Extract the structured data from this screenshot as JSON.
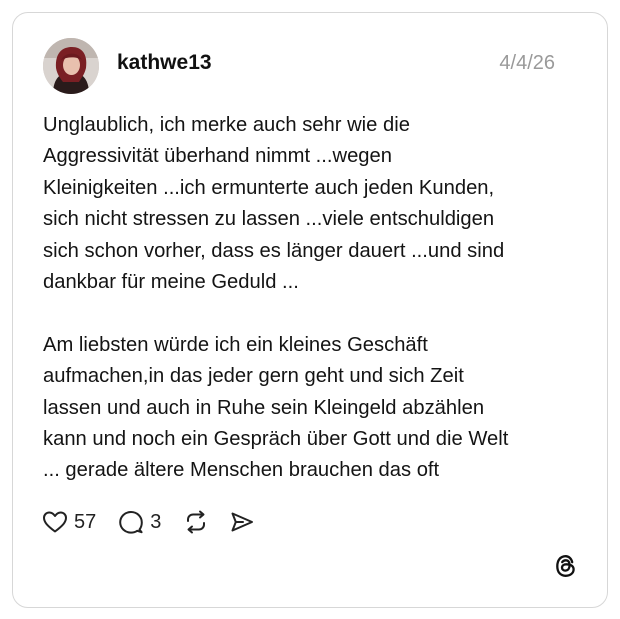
{
  "post": {
    "username": "kathwe13",
    "date": "4/4/26",
    "paragraphs": [
      "Unglaublich, ich merke auch sehr wie die\nAggressivität überhand nimmt ...wegen\nKleinigkeiten ...ich ermunterte auch jeden Kunden,\nsich nicht stressen zu lassen ...viele entschuldigen\nsich schon vorher, dass es länger dauert ...und sind\ndankbar für meine Geduld ...",
      "Am liebsten würde ich ein kleines Geschäft\naufmachen,in das jeder gern geht und sich Zeit\nlassen und auch in Ruhe sein Kleingeld abzählen\nkann und noch ein Gespräch über Gott und die Welt\n... gerade ältere Menschen brauchen das oft"
    ]
  },
  "actions": {
    "like_count": "57",
    "reply_count": "3",
    "icons": [
      "heart-icon",
      "comment-icon",
      "repost-icon",
      "share-icon"
    ]
  },
  "brand": {
    "logo": "threads-logo-icon"
  }
}
